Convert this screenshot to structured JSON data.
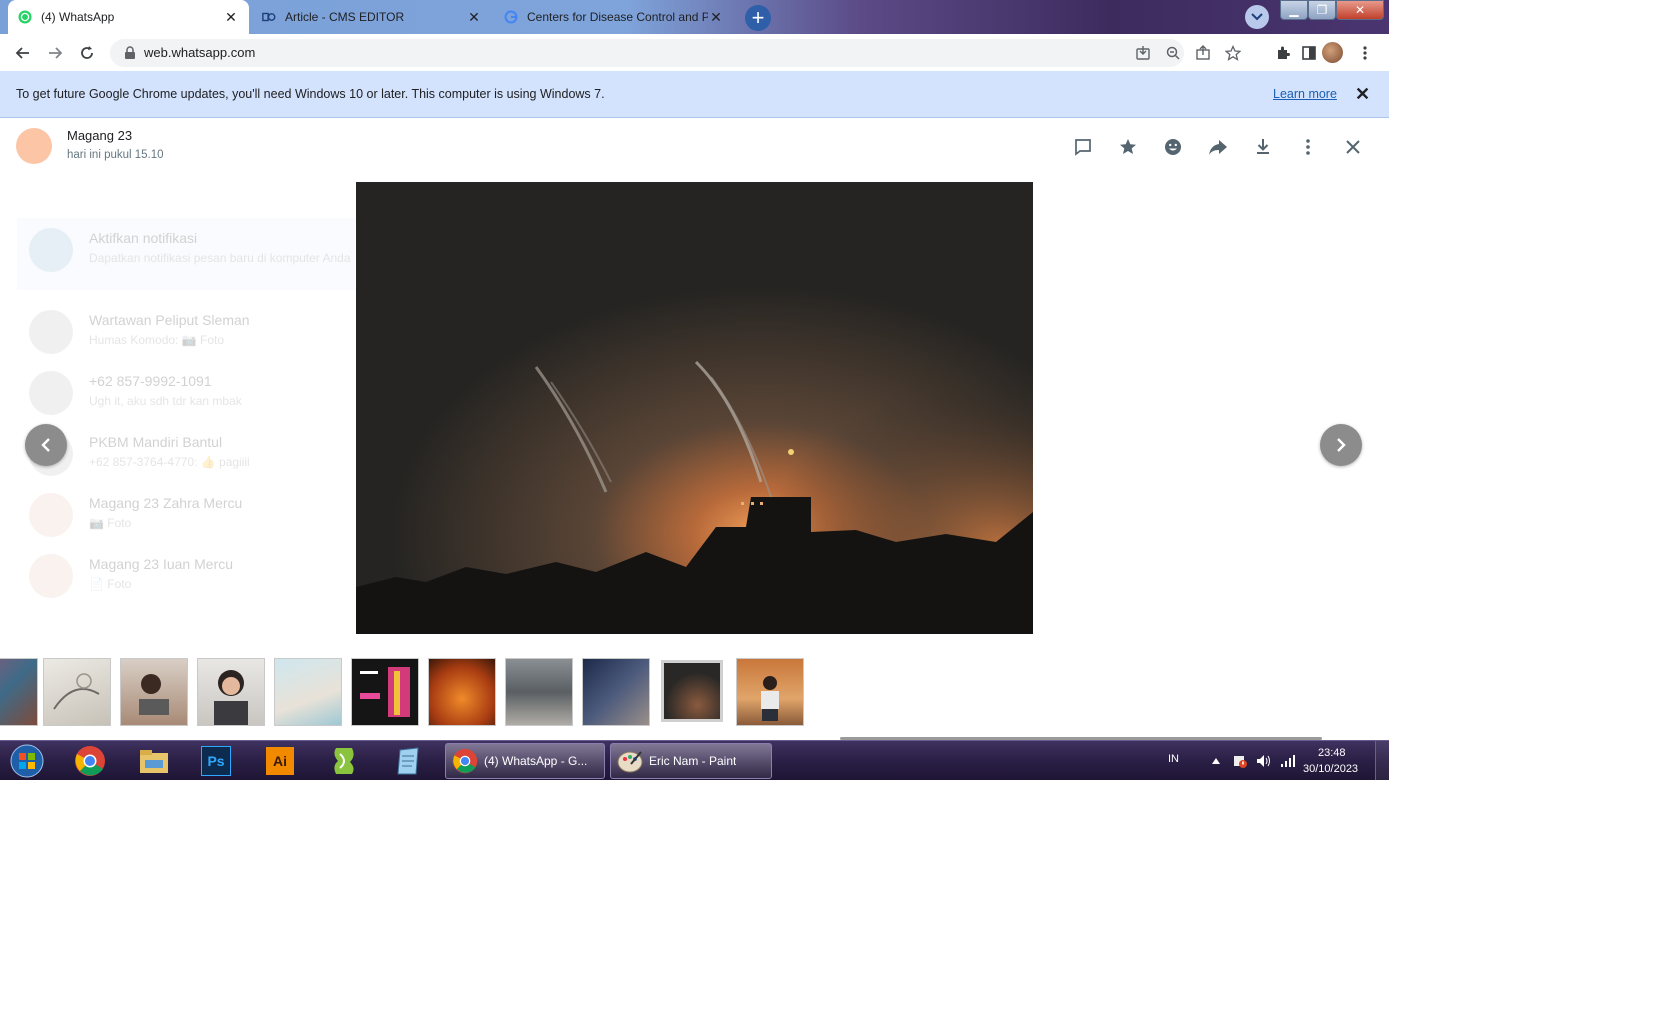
{
  "browser": {
    "tabs": [
      {
        "title": "(4) WhatsApp",
        "icon": "whatsapp-icon",
        "active": true
      },
      {
        "title": "Article - CMS EDITOR",
        "icon": "cms-icon",
        "active": false
      },
      {
        "title": "Centers for Disease Control and P",
        "icon": "google-icon",
        "active": false
      }
    ],
    "url": "web.whatsapp.com"
  },
  "infobar": {
    "message": "To get future Google Chrome updates, you'll need Windows 10 or later. This computer is using Windows 7.",
    "learn_more": "Learn more"
  },
  "media_viewer": {
    "sender_name": "Magang 23",
    "timestamp": "hari ini pukul 15.10",
    "header_icons": [
      "reply-icon",
      "star-icon",
      "emoji-icon",
      "forward-icon",
      "download-icon",
      "menu-icon",
      "close-icon"
    ],
    "thumbnails": [
      "women-photo",
      "sketch-photo",
      "woman-laptop-photo",
      "smiling-woman-photo",
      "woman-pool-photo",
      "magazine-photo",
      "city-fire-photo",
      "rubble-photo",
      "night-street-photo",
      "night-explosion-photo",
      "man-sitting-photo"
    ],
    "selected_thumbnail_index": 9
  },
  "background_chats": [
    {
      "name": "Aktifkan notifikasi",
      "message": "Dapatkan notifikasi pesan baru di komputer Anda"
    },
    {
      "name": "Wartawan Peliput Sleman",
      "message": "Humas Komodo: 📷 Foto"
    },
    {
      "name": "+62 857-9992-1091",
      "message": "Ugh it, aku sdh tdr kan mbak"
    },
    {
      "name": "PKBM Mandiri Bantul",
      "message": "+62 857-3764-4770: 👍 pagiiii"
    },
    {
      "name": "Magang 23 Zahra Mercu",
      "message": "📷 Foto"
    },
    {
      "name": "Magang 23 Iuan Mercu",
      "message": "📄 Foto"
    }
  ],
  "taskbar": {
    "pinned": [
      "chrome-icon",
      "explorer-icon",
      "photoshop-icon",
      "illustrator-icon",
      "coreldraw-icon",
      "notepad-icon"
    ],
    "photoshop_label": "Ps",
    "illustrator_label": "Ai",
    "tasks": [
      {
        "label": "(4) WhatsApp - G...",
        "icon": "chrome-icon"
      },
      {
        "label": "Eric Nam - Paint",
        "icon": "paint-icon"
      }
    ],
    "language": "IN",
    "time": "23:48",
    "date": "30/10/2023"
  },
  "colors": {
    "infobar_bg": "#d3e3fd",
    "avatar": "#fcc5a6",
    "link": "#1a5fb4"
  }
}
